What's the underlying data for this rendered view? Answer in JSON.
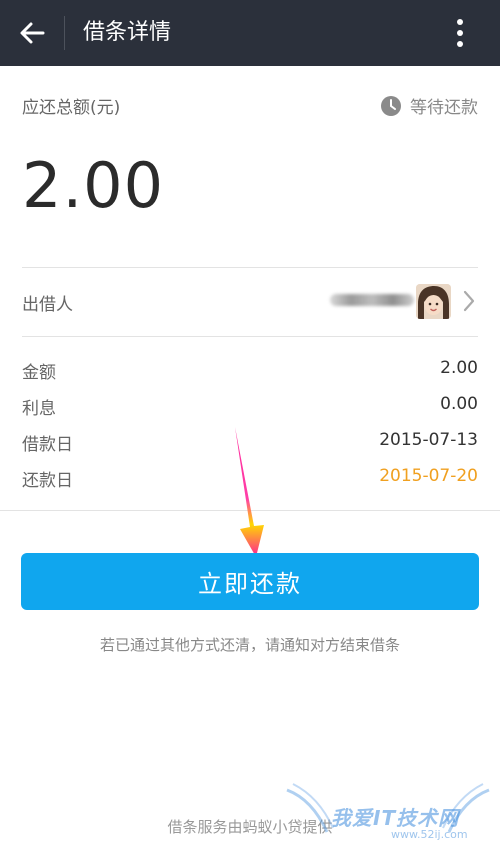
{
  "appbar": {
    "title": "借条详情",
    "back_icon": "arrow-left-icon",
    "more_icon": "more-vertical-icon"
  },
  "summary": {
    "total_label": "应还总额(元)",
    "status_text": "等待还款",
    "status_icon": "clock-icon",
    "amount": "2.00"
  },
  "lender": {
    "label": "出借人"
  },
  "details": [
    {
      "label": "金额",
      "value": "2.00"
    },
    {
      "label": "利息",
      "value": "0.00"
    },
    {
      "label": "借款日",
      "value": "2015-07-13"
    },
    {
      "label": "还款日",
      "value": "2015-07-20"
    }
  ],
  "colors": {
    "appbar": "#2b303b",
    "primary_button": "#10a6ee",
    "due_date": "#f0a020"
  },
  "actions": {
    "pay_label": "立即还款",
    "hint": "若已通过其他方式还清，请通知对方结束借条"
  },
  "footer": {
    "text": "借条服务由蚂蚁小贷提供"
  },
  "watermark": {
    "text": "我爱IT技术网",
    "url": "www.52ij.com"
  }
}
